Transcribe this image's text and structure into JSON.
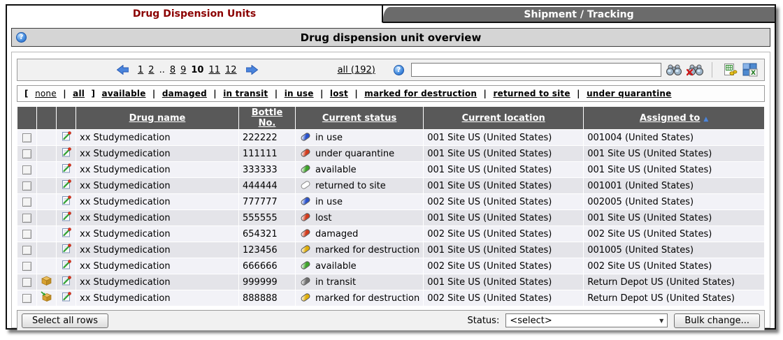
{
  "tabs": [
    {
      "label": "Drug Dispension Units",
      "active": true
    },
    {
      "label": "Shipment / Tracking",
      "active": false
    }
  ],
  "header": {
    "title": "Drug dispension unit overview",
    "help_icon": "help-icon"
  },
  "toolbar": {
    "pagination": {
      "prev_icon": "arrow-left-icon",
      "next_icon": "arrow-right-icon",
      "pages": [
        {
          "label": "1"
        },
        {
          "label": "2"
        },
        {
          "label": "..",
          "gap": true
        },
        {
          "label": "8"
        },
        {
          "label": "9"
        },
        {
          "label": "10",
          "current": true
        },
        {
          "label": "11"
        },
        {
          "label": "12"
        }
      ]
    },
    "all_link": "all (192)",
    "search": {
      "value": "",
      "placeholder": ""
    },
    "icons": {
      "search": "binoculars-icon",
      "clear_search": "binoculars-clear-icon",
      "export_excel": "excel-export-icon",
      "export_excel_grid": "excel-grid-icon"
    }
  },
  "filters": {
    "bracket_group": [
      "none",
      "all"
    ],
    "statuses": [
      "available",
      "damaged",
      "in transit",
      "in use",
      "lost",
      "marked for destruction",
      "returned to site",
      "under quarantine"
    ]
  },
  "table": {
    "columns": [
      "Drug name",
      "Bottle No.",
      "Current status",
      "Current location",
      "Assigned to"
    ],
    "sort": {
      "column": "Assigned to",
      "direction": "ascending"
    },
    "status_colors": {
      "in use": "#2a52cc",
      "under quarantine": "#d23c1e",
      "available": "#3ea32a",
      "returned to site": "#ffffff",
      "lost": "#d23c1e",
      "damaged": "#d23c1e",
      "marked for destruction": "#dfae0a",
      "in transit": "#6e6e6e"
    },
    "rows": [
      {
        "drug": "xx Studymedication",
        "bottle": "222222",
        "status": "in use",
        "location": "001 Site US (United States)",
        "assigned": "001004 (United States)",
        "package": null
      },
      {
        "drug": "xx Studymedication",
        "bottle": "111111",
        "status": "under quarantine",
        "location": "001 Site US (United States)",
        "assigned": "001 Site US (United States)",
        "package": null
      },
      {
        "drug": "xx Studymedication",
        "bottle": "333333",
        "status": "available",
        "location": "001 Site US (United States)",
        "assigned": "001 Site US (United States)",
        "package": null
      },
      {
        "drug": "xx Studymedication",
        "bottle": "444444",
        "status": "returned to site",
        "location": "001 Site US (United States)",
        "assigned": "001001 (United States)",
        "package": null
      },
      {
        "drug": "xx Studymedication",
        "bottle": "777777",
        "status": "in use",
        "location": "002 Site US (United States)",
        "assigned": "002005 (United States)",
        "package": null
      },
      {
        "drug": "xx Studymedication",
        "bottle": "555555",
        "status": "lost",
        "location": "001 Site US (United States)",
        "assigned": "001 Site US (United States)",
        "package": null
      },
      {
        "drug": "xx Studymedication",
        "bottle": "654321",
        "status": "damaged",
        "location": "002 Site US (United States)",
        "assigned": "002 Site US (United States)",
        "package": null
      },
      {
        "drug": "xx Studymedication",
        "bottle": "123456",
        "status": "marked for destruction",
        "location": "001 Site US (United States)",
        "assigned": "001005 (United States)",
        "package": null
      },
      {
        "drug": "xx Studymedication",
        "bottle": "666666",
        "status": "available",
        "location": "002 Site US (United States)",
        "assigned": "002 Site US (United States)",
        "package": null
      },
      {
        "drug": "xx Studymedication",
        "bottle": "999999",
        "status": "in transit",
        "location": "001 Site US (United States)",
        "assigned": "Return Depot US (United States)",
        "package": "box"
      },
      {
        "drug": "xx Studymedication",
        "bottle": "888888",
        "status": "marked for destruction",
        "location": "002 Site US (United States)",
        "assigned": "Return Depot US (United States)",
        "package": "box-arrow"
      }
    ]
  },
  "footer": {
    "select_all_label": "Select all rows",
    "status_label": "Status:",
    "status_value": "<select>",
    "bulk_change_label": "Bulk change..."
  }
}
